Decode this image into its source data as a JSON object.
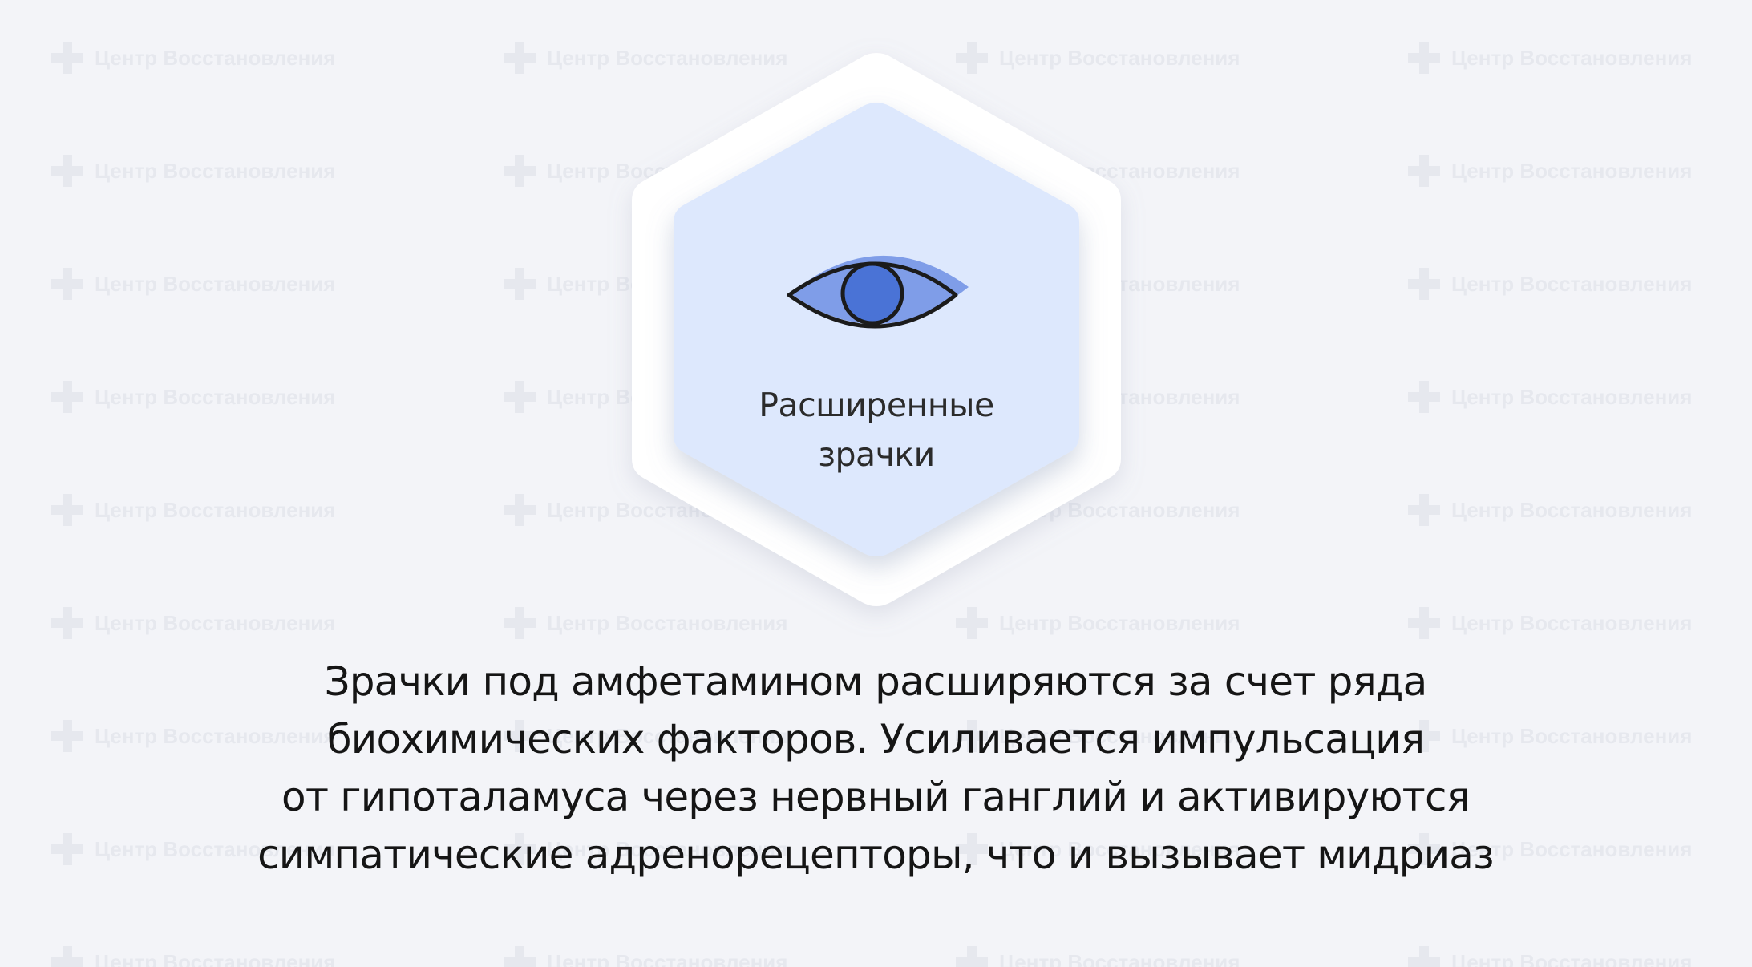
{
  "watermark": {
    "text": "Центр Восстановления",
    "icon": "medical-cross-icon"
  },
  "card": {
    "icon": "eye-icon",
    "title_lines": [
      "Расширенные",
      "зрачки"
    ]
  },
  "description": {
    "lines": [
      "Зрачки под амфетамином расширяются за счет ряда",
      "биохимических факторов. Усиливается импульсация",
      "от гипоталамуса через нервный ганглий и активируются",
      "симпатические адренорецепторы, что  и вызывает мидриаз"
    ]
  },
  "colors": {
    "background": "#f3f4f8",
    "outer_hex": "#ffffff",
    "inner_hex": "#dde8fd",
    "eye_fill": "#7f9de8",
    "iris": "#4a73d6",
    "watermark": "#e6e8ee"
  }
}
